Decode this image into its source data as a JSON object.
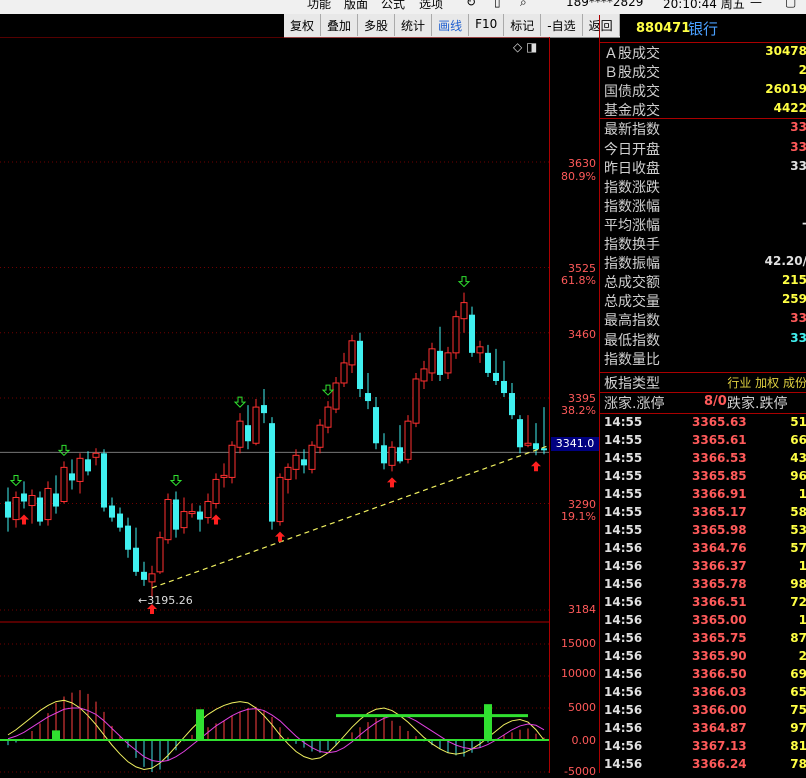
{
  "menu": {
    "items": [
      "功能",
      "版面",
      "公式",
      "选项"
    ],
    "user": "189****2829",
    "clock": "20:10:44 周五"
  },
  "toolbar": {
    "items": [
      "复权",
      "叠加",
      "多股",
      "统计",
      "画线",
      "F10",
      "标记",
      "-自选",
      "返回"
    ],
    "active": "画线"
  },
  "instrument": {
    "code": "880471",
    "name": "银行"
  },
  "axis": {
    "price_labels": [
      {
        "value": "3630",
        "pct": "80.9%"
      },
      {
        "value": "3525",
        "pct": "61.8%"
      },
      {
        "value": "3460",
        "pct": ""
      },
      {
        "value": "3395",
        "pct": "38.2%"
      },
      {
        "value": "3290",
        "pct": "19.1%"
      },
      {
        "value": "3184",
        "pct": ""
      }
    ],
    "current_price_tag": "3341.0",
    "indicator_labels": [
      "15000",
      "10000",
      "5000",
      "0.00",
      "-5000"
    ]
  },
  "chart": {
    "low_annotation": "3195.26",
    "colors": {
      "up": "#ff3030",
      "down": "#40f0f0",
      "trendline": "#f0f060",
      "buy_arrow": "#ff2020",
      "sell_arrow": "#30e030",
      "grid": "#700000"
    }
  },
  "chart_data": {
    "type": "candlestick",
    "y_range": [
      3184,
      3630
    ],
    "candles": [
      {
        "o": 3292,
        "h": 3306,
        "l": 3262,
        "c": 3276
      },
      {
        "o": 3274,
        "h": 3302,
        "l": 3266,
        "c": 3296
      },
      {
        "o": 3300,
        "h": 3312,
        "l": 3285,
        "c": 3292
      },
      {
        "o": 3288,
        "h": 3304,
        "l": 3270,
        "c": 3298
      },
      {
        "o": 3296,
        "h": 3302,
        "l": 3268,
        "c": 3272
      },
      {
        "o": 3274,
        "h": 3312,
        "l": 3268,
        "c": 3305
      },
      {
        "o": 3300,
        "h": 3318,
        "l": 3280,
        "c": 3287
      },
      {
        "o": 3292,
        "h": 3332,
        "l": 3290,
        "c": 3326
      },
      {
        "o": 3320,
        "h": 3334,
        "l": 3304,
        "c": 3313
      },
      {
        "o": 3312,
        "h": 3340,
        "l": 3300,
        "c": 3335
      },
      {
        "o": 3334,
        "h": 3342,
        "l": 3318,
        "c": 3322
      },
      {
        "o": 3336,
        "h": 3345,
        "l": 3328,
        "c": 3340
      },
      {
        "o": 3340,
        "h": 3344,
        "l": 3282,
        "c": 3286
      },
      {
        "o": 3288,
        "h": 3296,
        "l": 3272,
        "c": 3276
      },
      {
        "o": 3280,
        "h": 3286,
        "l": 3262,
        "c": 3266
      },
      {
        "o": 3268,
        "h": 3276,
        "l": 3236,
        "c": 3244
      },
      {
        "o": 3246,
        "h": 3266,
        "l": 3218,
        "c": 3222
      },
      {
        "o": 3222,
        "h": 3232,
        "l": 3208,
        "c": 3214
      },
      {
        "o": 3212,
        "h": 3228,
        "l": 3196,
        "c": 3220
      },
      {
        "o": 3222,
        "h": 3262,
        "l": 3220,
        "c": 3256
      },
      {
        "o": 3254,
        "h": 3300,
        "l": 3250,
        "c": 3294
      },
      {
        "o": 3294,
        "h": 3302,
        "l": 3256,
        "c": 3264
      },
      {
        "o": 3266,
        "h": 3296,
        "l": 3260,
        "c": 3282
      },
      {
        "o": 3280,
        "h": 3290,
        "l": 3276,
        "c": 3282
      },
      {
        "o": 3282,
        "h": 3288,
        "l": 3262,
        "c": 3274
      },
      {
        "o": 3276,
        "h": 3300,
        "l": 3270,
        "c": 3292
      },
      {
        "o": 3290,
        "h": 3320,
        "l": 3285,
        "c": 3314
      },
      {
        "o": 3316,
        "h": 3330,
        "l": 3306,
        "c": 3318
      },
      {
        "o": 3316,
        "h": 3352,
        "l": 3310,
        "c": 3348
      },
      {
        "o": 3346,
        "h": 3380,
        "l": 3340,
        "c": 3372
      },
      {
        "o": 3368,
        "h": 3388,
        "l": 3344,
        "c": 3352
      },
      {
        "o": 3350,
        "h": 3394,
        "l": 3348,
        "c": 3386
      },
      {
        "o": 3388,
        "h": 3404,
        "l": 3370,
        "c": 3380
      },
      {
        "o": 3370,
        "h": 3376,
        "l": 3264,
        "c": 3272
      },
      {
        "o": 3272,
        "h": 3320,
        "l": 3268,
        "c": 3316
      },
      {
        "o": 3314,
        "h": 3330,
        "l": 3300,
        "c": 3326
      },
      {
        "o": 3324,
        "h": 3344,
        "l": 3314,
        "c": 3338
      },
      {
        "o": 3334,
        "h": 3344,
        "l": 3320,
        "c": 3328
      },
      {
        "o": 3324,
        "h": 3352,
        "l": 3320,
        "c": 3348
      },
      {
        "o": 3346,
        "h": 3374,
        "l": 3340,
        "c": 3368
      },
      {
        "o": 3366,
        "h": 3392,
        "l": 3360,
        "c": 3386
      },
      {
        "o": 3384,
        "h": 3416,
        "l": 3380,
        "c": 3410
      },
      {
        "o": 3410,
        "h": 3440,
        "l": 3406,
        "c": 3430
      },
      {
        "o": 3428,
        "h": 3458,
        "l": 3420,
        "c": 3452
      },
      {
        "o": 3452,
        "h": 3460,
        "l": 3396,
        "c": 3404
      },
      {
        "o": 3400,
        "h": 3420,
        "l": 3384,
        "c": 3392
      },
      {
        "o": 3386,
        "h": 3396,
        "l": 3344,
        "c": 3350
      },
      {
        "o": 3348,
        "h": 3360,
        "l": 3324,
        "c": 3330
      },
      {
        "o": 3328,
        "h": 3352,
        "l": 3322,
        "c": 3346
      },
      {
        "o": 3346,
        "h": 3368,
        "l": 3330,
        "c": 3332
      },
      {
        "o": 3334,
        "h": 3378,
        "l": 3330,
        "c": 3372
      },
      {
        "o": 3370,
        "h": 3420,
        "l": 3366,
        "c": 3414
      },
      {
        "o": 3412,
        "h": 3432,
        "l": 3404,
        "c": 3424
      },
      {
        "o": 3420,
        "h": 3450,
        "l": 3412,
        "c": 3444
      },
      {
        "o": 3442,
        "h": 3466,
        "l": 3412,
        "c": 3418
      },
      {
        "o": 3420,
        "h": 3446,
        "l": 3414,
        "c": 3440
      },
      {
        "o": 3440,
        "h": 3482,
        "l": 3434,
        "c": 3476
      },
      {
        "o": 3474,
        "h": 3500,
        "l": 3460,
        "c": 3490
      },
      {
        "o": 3478,
        "h": 3486,
        "l": 3436,
        "c": 3440
      },
      {
        "o": 3440,
        "h": 3452,
        "l": 3430,
        "c": 3446
      },
      {
        "o": 3440,
        "h": 3448,
        "l": 3416,
        "c": 3420
      },
      {
        "o": 3420,
        "h": 3444,
        "l": 3408,
        "c": 3412
      },
      {
        "o": 3412,
        "h": 3432,
        "l": 3396,
        "c": 3400
      },
      {
        "o": 3400,
        "h": 3410,
        "l": 3374,
        "c": 3378
      },
      {
        "o": 3374,
        "h": 3378,
        "l": 3340,
        "c": 3346
      },
      {
        "o": 3348,
        "h": 3378,
        "l": 3346,
        "c": 3350
      },
      {
        "o": 3350,
        "h": 3370,
        "l": 3338,
        "c": 3344
      },
      {
        "o": 3345,
        "h": 3386,
        "l": 3339,
        "c": 3343
      }
    ],
    "trendline": {
      "from": {
        "index": 18,
        "value": 3206
      },
      "to": {
        "index": 67,
        "value": 3346
      }
    },
    "buy_signals": [
      2,
      18,
      26,
      34,
      48,
      66
    ],
    "sell_signals": [
      1,
      7,
      21,
      29,
      40,
      57
    ],
    "indicator": {
      "type": "macd",
      "range": [
        -5000,
        16000
      ],
      "histogram": [
        -800,
        -400,
        200,
        1400,
        2600,
        4200,
        5800,
        6800,
        7400,
        7800,
        7200,
        6000,
        4400,
        2200,
        600,
        -1200,
        -2800,
        -4200,
        -5000,
        -4600,
        -3200,
        -1600,
        -200,
        800,
        1400,
        2000,
        2600,
        3000,
        3800,
        4400,
        5000,
        5200,
        4600,
        3600,
        2000,
        400,
        -600,
        -1200,
        -1800,
        -2000,
        -1600,
        -800,
        200,
        1200,
        2000,
        2800,
        3400,
        3600,
        3000,
        2200,
        1400,
        600,
        -200,
        -800,
        -1400,
        -2000,
        -2400,
        -2600,
        -2000,
        -1200,
        -400,
        200,
        800,
        1200,
        1600,
        1800,
        1000,
        400
      ],
      "dif": [
        800,
        1600,
        2600,
        3600,
        4600,
        5400,
        6000,
        6200,
        5800,
        5000,
        3800,
        2400,
        800,
        -800,
        -2200,
        -3400,
        -4200,
        -4600,
        -4400,
        -3600,
        -2400,
        -1000,
        400,
        1800,
        3000,
        4000,
        4800,
        5400,
        5800,
        6000,
        5800,
        5000,
        3800,
        2400,
        800,
        -600,
        -1800,
        -2600,
        -3000,
        -2800,
        -2000,
        -800,
        600,
        2000,
        3200,
        4200,
        4800,
        5000,
        4600,
        3800,
        2800,
        1600,
        400,
        -600,
        -1400,
        -2000,
        -2200,
        -2000,
        -1400,
        -600,
        400,
        1400,
        2400,
        3000,
        3200,
        2800,
        1600,
        0
      ],
      "dea": [
        200,
        600,
        1200,
        2000,
        2800,
        3600,
        4200,
        4800,
        5000,
        5000,
        4600,
        4000,
        3000,
        1800,
        600,
        -600,
        -1600,
        -2600,
        -3200,
        -3400,
        -3200,
        -2600,
        -1800,
        -800,
        200,
        1200,
        2200,
        3000,
        3800,
        4400,
        4800,
        4900,
        4600,
        3900,
        3000,
        1800,
        600,
        -400,
        -1200,
        -1800,
        -2000,
        -1800,
        -1200,
        -300,
        800,
        1800,
        2700,
        3400,
        3800,
        3900,
        3600,
        3000,
        2200,
        1400,
        600,
        -200,
        -800,
        -1200,
        -1400,
        -1200,
        -700,
        0,
        800,
        1600,
        2200,
        2500,
        2300,
        1600
      ],
      "signal_line": {
        "from_index": 41,
        "to_index": 65,
        "value": 3800
      },
      "markers": [
        {
          "index": 6,
          "value": 1500
        },
        {
          "index": 24,
          "value": 4800
        },
        {
          "index": 60,
          "value": 5600
        }
      ]
    }
  },
  "right_panel": {
    "stats": [
      {
        "label": "Ａ股成交",
        "value": "30478",
        "color": "#ffff44"
      },
      {
        "label": "Ｂ股成交",
        "value": "2",
        "color": "#ffff44"
      },
      {
        "label": "国债成交",
        "value": "26019",
        "color": "#ffff44"
      },
      {
        "label": "基金成交",
        "value": "4422",
        "color": "#ffff44"
      },
      {
        "label": "最新指数",
        "value": "33",
        "color": "#ff5a5a"
      },
      {
        "label": "今日开盘",
        "value": "33",
        "color": "#ff5a5a"
      },
      {
        "label": "昨日收盘",
        "value": "33",
        "color": "#e0e0e0"
      },
      {
        "label": "指数涨跌",
        "value": "",
        "color": "#ff5a5a"
      },
      {
        "label": "指数涨幅",
        "value": "",
        "color": "#ff5a5a"
      },
      {
        "label": "平均涨幅",
        "value": "-",
        "color": "#e0e0e0"
      },
      {
        "label": "指数换手",
        "value": "",
        "color": "#e0e0e0"
      },
      {
        "label": "指数振幅",
        "value": "42.20/",
        "color": "#e0e0e0"
      },
      {
        "label": "总成交额",
        "value": "215",
        "color": "#ffff44"
      },
      {
        "label": "总成交量",
        "value": "259",
        "color": "#ffff44"
      },
      {
        "label": "最高指数",
        "value": "33",
        "color": "#ff5a5a"
      },
      {
        "label": "最低指数",
        "value": "33",
        "color": "#40f0f0"
      },
      {
        "label": "指数量比",
        "value": "",
        "color": "#e0e0e0"
      }
    ],
    "board_type": {
      "label": "板指类型",
      "value": "行业 加权 成份"
    },
    "limit_row": {
      "label1": "涨家.涨停",
      "value": "8/0",
      "label2": "跌家.跌停"
    },
    "ticks": [
      {
        "t": "14:55",
        "p": "3365.63",
        "v": "51"
      },
      {
        "t": "14:55",
        "p": "3365.61",
        "v": "66"
      },
      {
        "t": "14:55",
        "p": "3366.53",
        "v": "43"
      },
      {
        "t": "14:55",
        "p": "3365.85",
        "v": "96"
      },
      {
        "t": "14:55",
        "p": "3366.91",
        "v": "1"
      },
      {
        "t": "14:55",
        "p": "3365.17",
        "v": "58"
      },
      {
        "t": "14:55",
        "p": "3365.98",
        "v": "53"
      },
      {
        "t": "14:56",
        "p": "3364.76",
        "v": "57"
      },
      {
        "t": "14:56",
        "p": "3366.37",
        "v": "1"
      },
      {
        "t": "14:56",
        "p": "3365.78",
        "v": "98"
      },
      {
        "t": "14:56",
        "p": "3366.51",
        "v": "72"
      },
      {
        "t": "14:56",
        "p": "3365.00",
        "v": "1"
      },
      {
        "t": "14:56",
        "p": "3365.75",
        "v": "87"
      },
      {
        "t": "14:56",
        "p": "3365.90",
        "v": "2"
      },
      {
        "t": "14:56",
        "p": "3366.50",
        "v": "69"
      },
      {
        "t": "14:56",
        "p": "3366.03",
        "v": "65"
      },
      {
        "t": "14:56",
        "p": "3366.00",
        "v": "75"
      },
      {
        "t": "14:56",
        "p": "3364.87",
        "v": "97"
      },
      {
        "t": "14:56",
        "p": "3367.13",
        "v": "81"
      },
      {
        "t": "14:56",
        "p": "3366.24",
        "v": "78"
      }
    ]
  }
}
